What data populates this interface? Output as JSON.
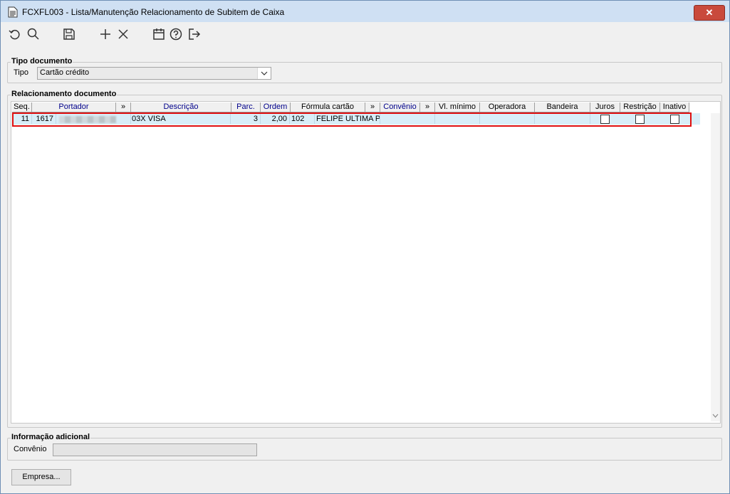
{
  "window": {
    "title": "FCXFL003 - Lista/Manutenção Relacionamento de Subitem de Caixa",
    "close_label": "✕"
  },
  "toolbar": {
    "icons": [
      "refresh-icon",
      "search-icon",
      "save-icon",
      "add-icon",
      "delete-icon",
      "calendar-icon",
      "help-icon",
      "exit-icon"
    ]
  },
  "tipo_documento": {
    "title": "Tipo documento",
    "label": "Tipo",
    "value": "Cartão crédito"
  },
  "relacionamento": {
    "title": "Relacionamento documento",
    "columns": [
      "Seq.",
      "Portador",
      "»",
      "Descrição",
      "Parc.",
      "Ordem",
      "Fórmula cartão",
      "»",
      "Convênio",
      "»",
      "Vl. mínimo",
      "Operadora",
      "Bandeira",
      "Juros",
      "Restrição",
      "Inativo"
    ],
    "rows": [
      {
        "seq": "11",
        "portador": "1617",
        "descricao": "03X VISA",
        "parc": "3",
        "ordem": "2,00",
        "formula_cod": "102",
        "formula_desc": "FELIPE ULTIMA PAI",
        "convenio": "",
        "vl_minimo": "",
        "operadora": "",
        "bandeira": ""
      }
    ]
  },
  "informacao": {
    "title": "Informação adicional",
    "label": "Convênio",
    "value": ""
  },
  "empresa_button": "Empresa..."
}
